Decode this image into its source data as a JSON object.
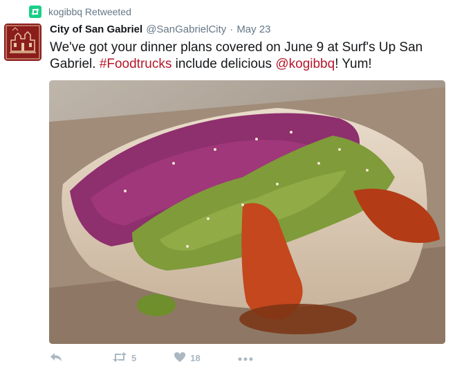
{
  "retweet_context": {
    "label": "kogibbq Retweeted",
    "icon": "retweet-icon"
  },
  "author": {
    "name": "City of San Gabriel",
    "handle": "@SanGabrielCity",
    "separator": "·",
    "date": "May 23",
    "avatar_color": "#8b1d1d"
  },
  "tweet": {
    "text_part1": "We've got your dinner plans covered on June 9 at Surf's Up San Gabriel. ",
    "hashtag": "#Foodtrucks",
    "text_part2": " include delicious ",
    "mention": "@kogibbq",
    "text_part3": "! Yum!"
  },
  "media": {
    "subject": "food-truck-burrito-photo"
  },
  "actions": {
    "reply": {
      "icon": "reply-icon"
    },
    "retweet": {
      "icon": "retweet-icon",
      "count": "5"
    },
    "like": {
      "icon": "heart-icon",
      "count": "18"
    },
    "more": {
      "icon": "more-icon"
    }
  },
  "colors": {
    "accent": "#b5182a",
    "retweet_green": "#19cf86",
    "muted": "#657786"
  }
}
